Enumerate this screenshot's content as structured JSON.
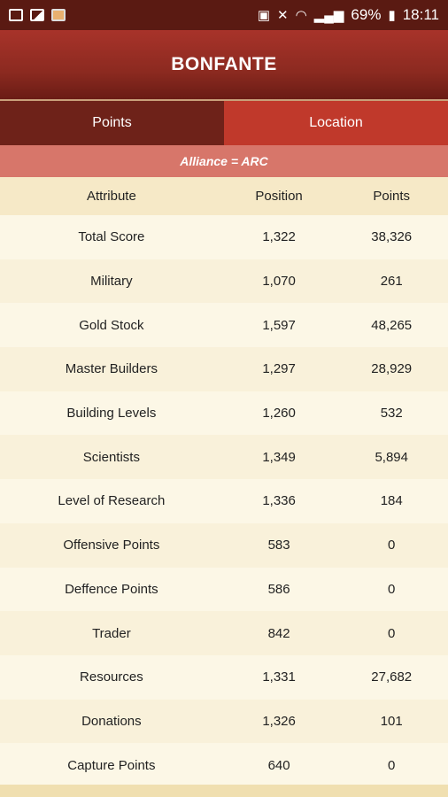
{
  "status_bar": {
    "time": "18:11",
    "battery": "69%",
    "icons": [
      "laptop-icon",
      "image-icon",
      "photo-icon",
      "battery-saver-icon",
      "mute-icon",
      "wifi-icon",
      "signal-icon",
      "battery-icon"
    ]
  },
  "header": {
    "title": "BONFANTE"
  },
  "tabs": [
    {
      "label": "Points",
      "active": true
    },
    {
      "label": "Location",
      "active": false
    }
  ],
  "alliance": {
    "text": "Alliance = ARC"
  },
  "table": {
    "headers": [
      "Attribute",
      "Position",
      "Points"
    ],
    "rows": [
      [
        "Total Score",
        "1,322",
        "38,326"
      ],
      [
        "Military",
        "1,070",
        "261"
      ],
      [
        "Gold Stock",
        "1,597",
        "48,265"
      ],
      [
        "Master Builders",
        "1,297",
        "28,929"
      ],
      [
        "Building Levels",
        "1,260",
        "532"
      ],
      [
        "Scientists",
        "1,349",
        "5,894"
      ],
      [
        "Level of Research",
        "1,336",
        "184"
      ],
      [
        "Offensive Points",
        "583",
        "0"
      ],
      [
        "Deffence Points",
        "586",
        "0"
      ],
      [
        "Trader",
        "842",
        "0"
      ],
      [
        "Resources",
        "1,331",
        "27,682"
      ],
      [
        "Donations",
        "1,326",
        "101"
      ],
      [
        "Capture Points",
        "640",
        "0"
      ]
    ]
  },
  "colors": {
    "header": "#8c2a20",
    "tab_active": "#6e2219",
    "tab_inactive": "#c0392b",
    "alliance_bar": "#d7766a",
    "background": "#fcf7e6"
  }
}
